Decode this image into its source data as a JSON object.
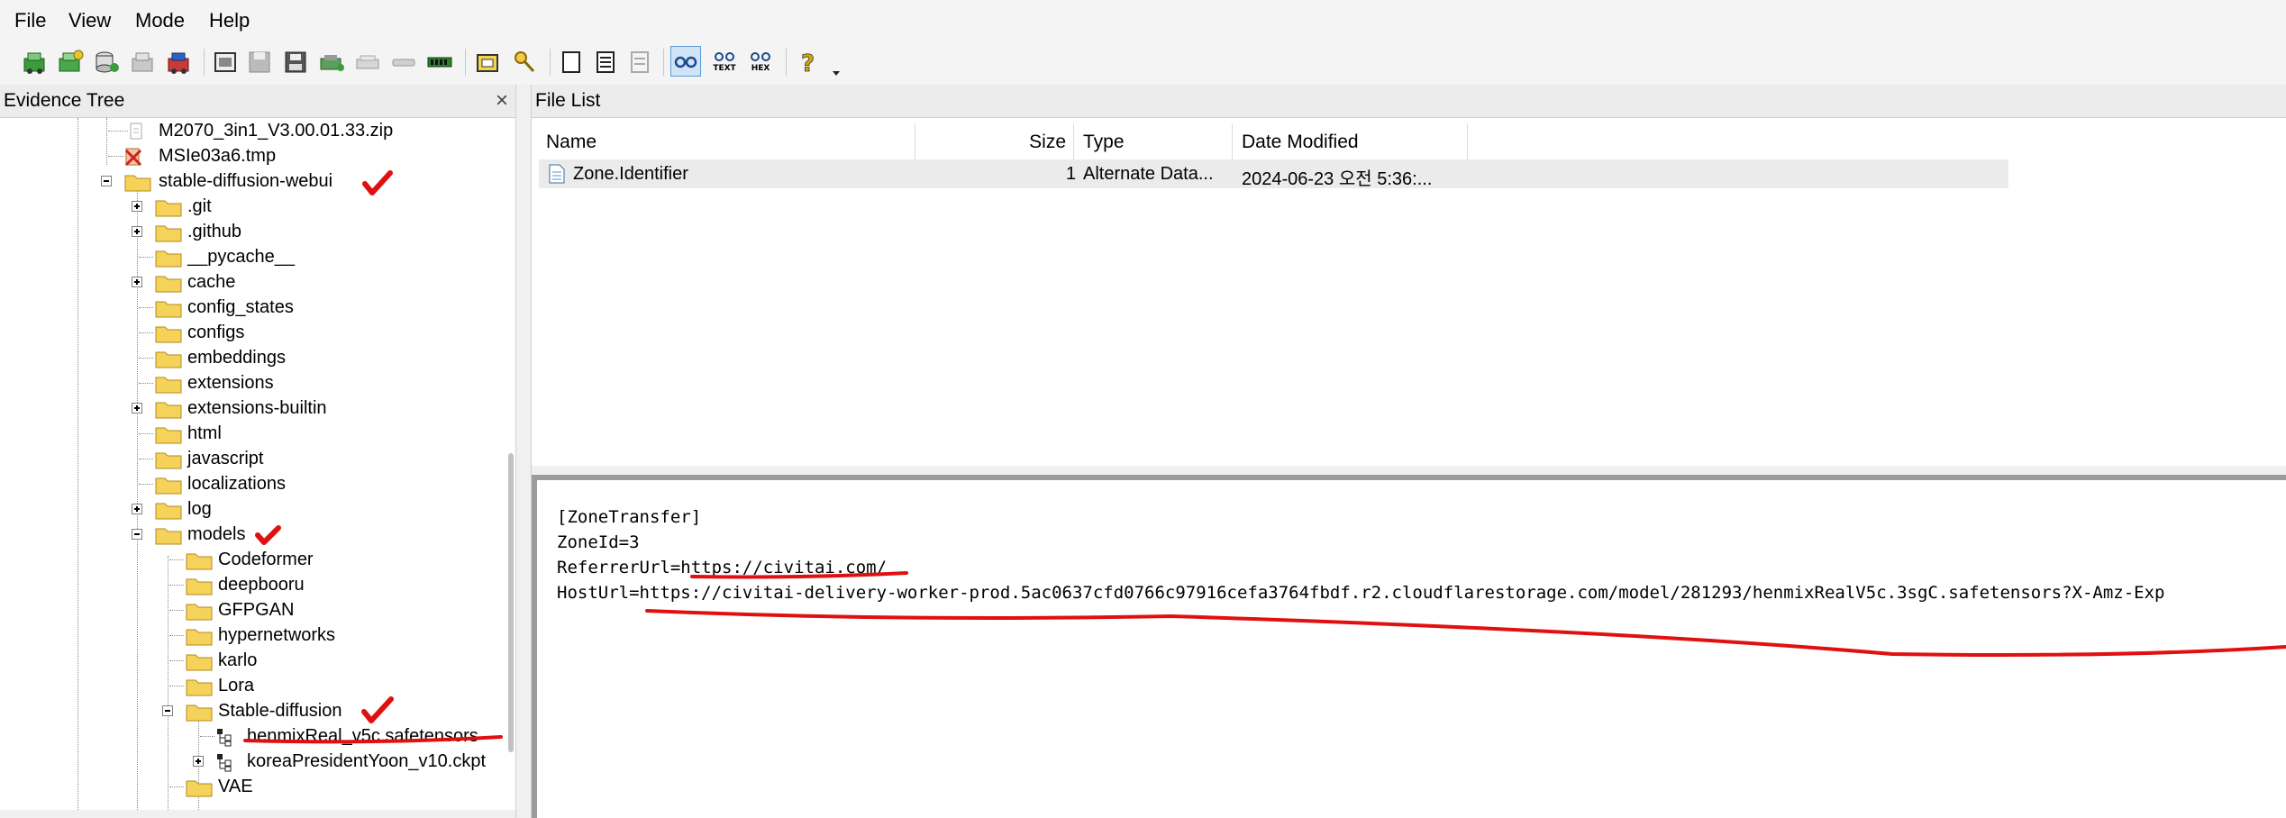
{
  "menu": {
    "file": "File",
    "view": "View",
    "mode": "Mode",
    "help": "Help"
  },
  "toolbar": {
    "text_label": "TEXT",
    "hex_label": "HEX",
    "buttons": [
      "add-evidence-icon",
      "add-all-icon",
      "add-image-icon",
      "remove-evidence-icon",
      "remove-all-icon",
      "image-file-icon",
      "save-icon",
      "export-icon",
      "disk-icon",
      "drive-icon",
      "hash-icon",
      "memory-icon",
      "folder-open-icon",
      "search-key-icon",
      "document-icon",
      "file-properties-icon",
      "file-view-icon",
      "glasses-view-icon",
      "text-view-icon",
      "hex-view-icon",
      "help-icon",
      "dropdown-icon"
    ]
  },
  "evidence_tree": {
    "title": "Evidence Tree",
    "close": "×",
    "items": [
      {
        "label": "M2070_3in1_V3.00.01.33.zip",
        "icon": "file-icon"
      },
      {
        "label": "MSIe03a6.tmp",
        "icon": "deleted-file-icon"
      },
      {
        "label": "stable-diffusion-webui",
        "icon": "folder-icon",
        "expanded": true
      },
      {
        "label": ".git",
        "icon": "folder-icon"
      },
      {
        "label": ".github",
        "icon": "folder-icon"
      },
      {
        "label": "__pycache__",
        "icon": "folder-icon"
      },
      {
        "label": "cache",
        "icon": "folder-icon"
      },
      {
        "label": "config_states",
        "icon": "folder-icon"
      },
      {
        "label": "configs",
        "icon": "folder-icon"
      },
      {
        "label": "embeddings",
        "icon": "folder-icon"
      },
      {
        "label": "extensions",
        "icon": "folder-icon"
      },
      {
        "label": "extensions-builtin",
        "icon": "folder-icon"
      },
      {
        "label": "html",
        "icon": "folder-icon"
      },
      {
        "label": "javascript",
        "icon": "folder-icon"
      },
      {
        "label": "localizations",
        "icon": "folder-icon"
      },
      {
        "label": "log",
        "icon": "folder-icon"
      },
      {
        "label": "models",
        "icon": "folder-icon",
        "expanded": true
      },
      {
        "label": "Codeformer",
        "icon": "folder-icon"
      },
      {
        "label": "deepbooru",
        "icon": "folder-icon"
      },
      {
        "label": "GFPGAN",
        "icon": "folder-icon"
      },
      {
        "label": "hypernetworks",
        "icon": "folder-icon"
      },
      {
        "label": "karlo",
        "icon": "folder-icon"
      },
      {
        "label": "Lora",
        "icon": "folder-icon"
      },
      {
        "label": "Stable-diffusion",
        "icon": "folder-icon",
        "expanded": true
      },
      {
        "label": "henmixReal_v5c.safetensors",
        "icon": "file-tree-icon"
      },
      {
        "label": "koreaPresidentYoon_v10.ckpt",
        "icon": "file-tree-icon"
      },
      {
        "label": "VAE",
        "icon": "folder-icon"
      }
    ]
  },
  "file_list": {
    "title": "File List",
    "columns": {
      "name": "Name",
      "size": "Size",
      "type": "Type",
      "date": "Date Modified"
    },
    "rows": [
      {
        "name": "Zone.Identifier",
        "size": "1",
        "type": "Alternate Data...",
        "date": "2024-06-23 오전 5:36:..."
      }
    ]
  },
  "viewer": {
    "lines": [
      "[ZoneTransfer]",
      "ZoneId=3",
      "ReferrerUrl=https://civitai.com/",
      "HostUrl=https://civitai-delivery-worker-prod.5ac0637cfd0766c97916cefa3764fbdf.r2.cloudflarestorage.com/model/281293/henmixRealV5c.3sgC.safetensors?X-Amz-Exp"
    ]
  },
  "colors": {
    "annotation_red": "#e01010",
    "folder_yellow": "#f5d35a",
    "folder_outline": "#b48a1c",
    "chrome_bg": "#f4f4f4",
    "selected_row": "#ebebeb"
  }
}
